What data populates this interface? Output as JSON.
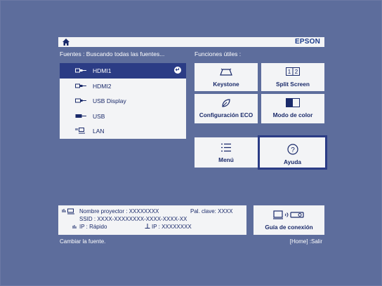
{
  "brand": "EPSON",
  "sources": {
    "header": "Fuentes :  Buscando todas las fuentes...",
    "items": [
      {
        "label": "HDMI1",
        "selected": true
      },
      {
        "label": "HDMI2",
        "selected": false
      },
      {
        "label": "USB Display",
        "selected": false
      },
      {
        "label": "USB",
        "selected": false
      },
      {
        "label": "LAN",
        "selected": false
      }
    ]
  },
  "functions": {
    "header": "Funciones útiles :",
    "keystone": "Keystone",
    "split_screen": "Split Screen",
    "eco": "Configuración ECO",
    "color_mode": "Modo de color",
    "menu": "Menú",
    "help": "Ayuda"
  },
  "network": {
    "projector_name_label": "Nombre proyector : XXXXXXXX",
    "passphrase_label": "Pal. clave: XXXX",
    "ssid_label": "SSID : XXXX-XXXXXXXX-XXXX-XXXX-XX",
    "ip_wireless_label": "IP : Rápido",
    "ip_wired_label": "IP : XXXXXXXX"
  },
  "connection_guide": "Guía de conexión",
  "footer": {
    "hint": "Cambiar la fuente.",
    "exit": "[Home] :Salir"
  },
  "colors": {
    "background": "#5d6d9c",
    "panel": "#f3f4f6",
    "accent": "#2b3c85",
    "text": "#1a2a6a"
  }
}
